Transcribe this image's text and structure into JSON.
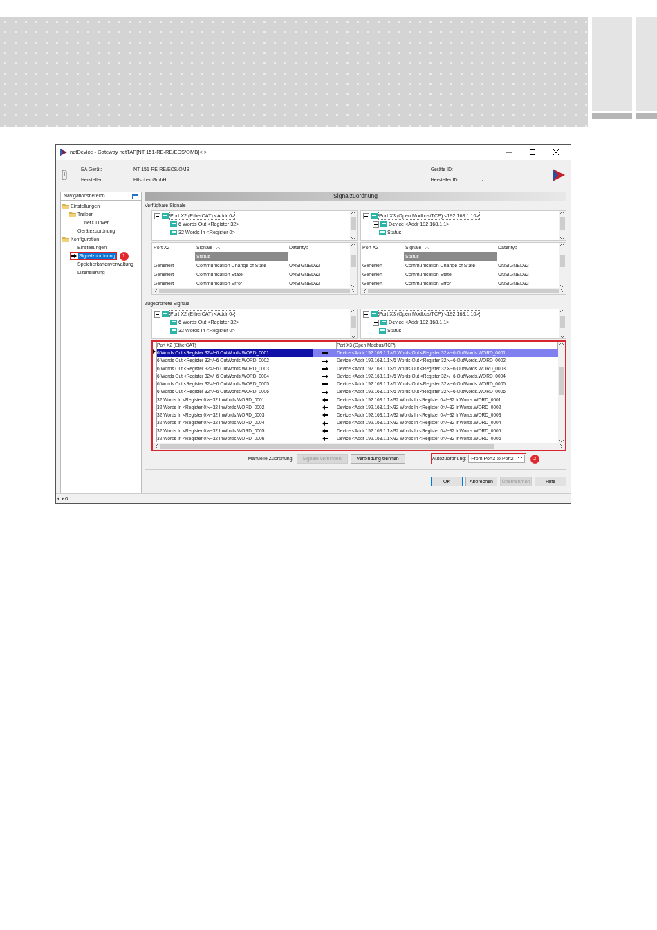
{
  "window": {
    "title": "netDevice - Gateway netTAP[NT 151-RE-RE/ECS/OMB]< >"
  },
  "device_info": {
    "left": [
      {
        "label": "EA Gerät:",
        "value": "NT 151-RE-RE/ECS/OMB"
      },
      {
        "label": "Hersteller:",
        "value": "Hilscher GmbH"
      }
    ],
    "right": [
      {
        "label": "Geräte ID:",
        "value": "-"
      },
      {
        "label": "Hersteller ID:",
        "value": "-"
      }
    ]
  },
  "navigation": {
    "title": "Navigationsbereich",
    "items": [
      {
        "label": "Einstellungen",
        "kind": "folder",
        "selected": false,
        "children": [
          {
            "label": "Treiber",
            "kind": "folder",
            "selected": false,
            "children": [
              {
                "label": "netX Driver",
                "kind": "page",
                "selected": false
              }
            ]
          },
          {
            "label": "Gerätezuordnung",
            "kind": "page",
            "selected": false
          }
        ]
      },
      {
        "label": "Konfiguration",
        "kind": "folder",
        "selected": false,
        "children": [
          {
            "label": "Einstellungen",
            "kind": "page",
            "selected": false
          },
          {
            "label": "Signalzuordnung",
            "kind": "page",
            "selected": true,
            "callout": "1"
          },
          {
            "label": "Speicherkartenverwaltung",
            "kind": "page",
            "selected": false
          },
          {
            "label": "Lizensierung",
            "kind": "page",
            "selected": false
          }
        ]
      }
    ]
  },
  "panel_title": "Signalzuordnung",
  "available": {
    "legend": "Verfügbare Signale",
    "left_tree": [
      {
        "label": "Port X2 (EtherCAT) <Addr 0>",
        "expanded": true,
        "children": [
          {
            "label": "6 Words Out <Register 32>"
          },
          {
            "label": "32 Words In <Register 0>"
          }
        ]
      }
    ],
    "right_tree": [
      {
        "label": "Port X3 (Open Modbus/TCP) <192.168.1.10>",
        "expanded": true,
        "children": [
          {
            "label": "Device <Addr 192.168.1.1>",
            "expanded": false
          },
          {
            "label": "Status"
          }
        ]
      }
    ],
    "left_table": {
      "columns": [
        "Port X2",
        "Signale",
        "Datentyp"
      ],
      "filter": "Status",
      "rows": [
        [
          "Generiert",
          "Communication Change of State",
          "UNSIGNED32"
        ],
        [
          "Generiert",
          "Communication State",
          "UNSIGNED32"
        ],
        [
          "Generiert",
          "Communication Error",
          "UNSIGNED32"
        ]
      ]
    },
    "right_table": {
      "columns": [
        "Port X3",
        "Signale",
        "Datentyp"
      ],
      "filter": "Status",
      "rows": [
        [
          "Generiert",
          "Communication Change of State",
          "UNSIGNED32"
        ],
        [
          "Generiert",
          "Communication State",
          "UNSIGNED32"
        ],
        [
          "Generiert",
          "Communication Error",
          "UNSIGNED32"
        ]
      ]
    }
  },
  "assigned": {
    "legend": "Zugeordnete Signale",
    "left_tree": [
      {
        "label": "Port X2 (EtherCAT) <Addr 0>",
        "expanded": true,
        "children": [
          {
            "label": "6 Words Out <Register 32>"
          },
          {
            "label": "32 Words In <Register 0>"
          }
        ]
      }
    ],
    "right_tree": [
      {
        "label": "Port X3 (Open Modbus/TCP) <192.168.1.10>",
        "expanded": true,
        "children": [
          {
            "label": "Device <Addr 192.168.1.1>",
            "expanded": false
          },
          {
            "label": "Status"
          }
        ]
      }
    ],
    "mapping": {
      "columns": [
        "Port X2 (EtherCAT)",
        "Port X3 (Open Modbus/TCP)"
      ],
      "rows": [
        {
          "source": "6 Words Out <Register 32>/~6 OutWords.WORD_0001",
          "kind": "out",
          "target": "Device <Addr 192.168.1.1>/6 Words Out <Register 32>/~6 OutWords.WORD_0001",
          "selected": true
        },
        {
          "source": "6 Words Out <Register 32>/~6 OutWords.WORD_0002",
          "kind": "out",
          "target": "Device <Addr 192.168.1.1>/6 Words Out <Register 32>/~6 OutWords.WORD_0002",
          "selected": false
        },
        {
          "source": "6 Words Out <Register 32>/~6 OutWords.WORD_0003",
          "kind": "out",
          "target": "Device <Addr 192.168.1.1>/6 Words Out <Register 32>/~6 OutWords.WORD_0003",
          "selected": false
        },
        {
          "source": "6 Words Out <Register 32>/~6 OutWords.WORD_0004",
          "kind": "out",
          "target": "Device <Addr 192.168.1.1>/6 Words Out <Register 32>/~6 OutWords.WORD_0004",
          "selected": false
        },
        {
          "source": "6 Words Out <Register 32>/~6 OutWords.WORD_0005",
          "kind": "out",
          "target": "Device <Addr 192.168.1.1>/6 Words Out <Register 32>/~6 OutWords.WORD_0005",
          "selected": false
        },
        {
          "source": "6 Words Out <Register 32>/~6 OutWords.WORD_0006",
          "kind": "out",
          "target": "Device <Addr 192.168.1.1>/6 Words Out <Register 32>/~6 OutWords.WORD_0006",
          "selected": false
        },
        {
          "source": "32 Words In <Register 0>/~32 InWords.WORD_0001",
          "kind": "in",
          "target": "Device <Addr 192.168.1.1>/32 Words In <Register 0>/~32 InWords.WORD_0001",
          "selected": false
        },
        {
          "source": "32 Words In <Register 0>/~32 InWords.WORD_0002",
          "kind": "in",
          "target": "Device <Addr 192.168.1.1>/32 Words In <Register 0>/~32 InWords.WORD_0002",
          "selected": false
        },
        {
          "source": "32 Words In <Register 0>/~32 InWords.WORD_0003",
          "kind": "in",
          "target": "Device <Addr 192.168.1.1>/32 Words In <Register 0>/~32 InWords.WORD_0003",
          "selected": false
        },
        {
          "source": "32 Words In <Register 0>/~32 InWords.WORD_0004",
          "kind": "in",
          "target": "Device <Addr 192.168.1.1>/32 Words In <Register 0>/~32 InWords.WORD_0004",
          "selected": false
        },
        {
          "source": "32 Words In <Register 0>/~32 InWords.WORD_0005",
          "kind": "in",
          "target": "Device <Addr 192.168.1.1>/32 Words In <Register 0>/~32 InWords.WORD_0005",
          "selected": false
        },
        {
          "source": "32 Words In <Register 0>/~32 InWords.WORD_0006",
          "kind": "in",
          "target": "Device <Addr 192.168.1.1>/32 Words In <Register 0>/~32 InWords.WORD_0006",
          "selected": false
        }
      ]
    }
  },
  "manual": {
    "label": "Manuelle Zuordnung:",
    "buttons": [
      {
        "label": "Signale verbinden",
        "disabled": true
      },
      {
        "label": "Verbindung trennen",
        "disabled": false
      }
    ]
  },
  "auto": {
    "label": "Autozuordnung:",
    "value": "From Port3 to Port2",
    "callout": "2"
  },
  "dialog_buttons": [
    {
      "label": "OK",
      "disabled": false
    },
    {
      "label": "Abbrechen",
      "disabled": false
    },
    {
      "label": "Übernehmen",
      "disabled": true
    },
    {
      "label": "Hilfe",
      "disabled": false
    }
  ],
  "status_bar": {
    "text": "0"
  }
}
